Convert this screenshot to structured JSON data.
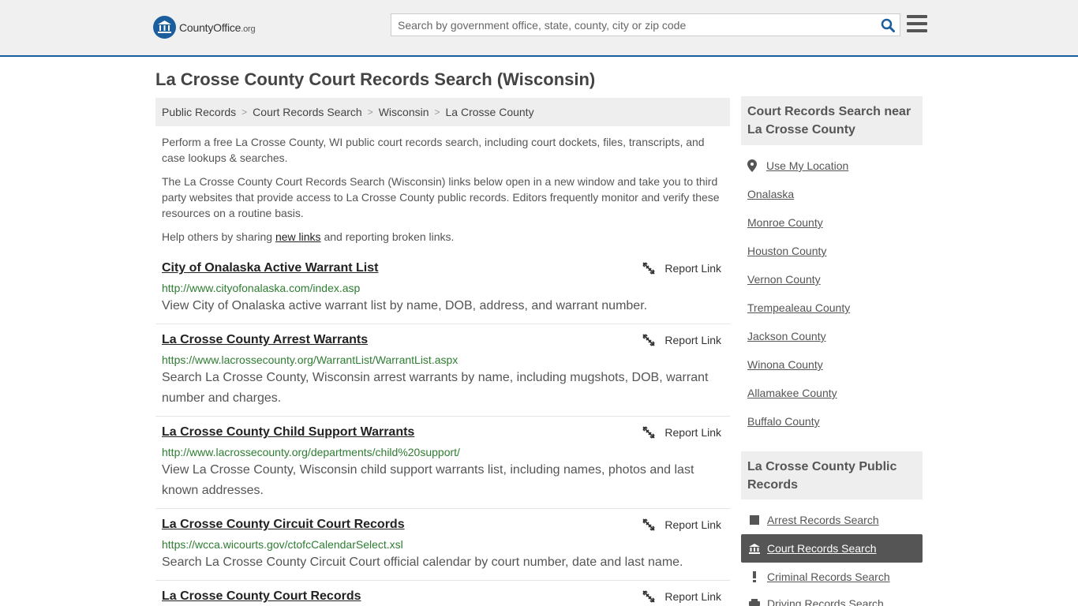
{
  "header": {
    "logo_main": "CountyOffice",
    "logo_suffix": ".org",
    "search_placeholder": "Search by government office, state, county, city or zip code"
  },
  "page_title": "La Crosse County Court Records Search (Wisconsin)",
  "breadcrumb": [
    "Public Records",
    "Court Records Search",
    "Wisconsin",
    "La Crosse County"
  ],
  "intro": {
    "p1": "Perform a free La Crosse County, WI public court records search, including court dockets, files, transcripts, and case lookups & searches.",
    "p2": "The La Crosse County Court Records Search (Wisconsin) links below open in a new window and take you to third party websites that provide access to La Crosse County public records. Editors frequently monitor and verify these resources on a routine basis.",
    "p3_before": "Help others by sharing ",
    "p3_link": "new links",
    "p3_after": " and reporting broken links."
  },
  "report_label": "Report Link",
  "results": [
    {
      "title": "City of Onalaska Active Warrant List",
      "url": "http://www.cityofonalaska.com/index.asp",
      "desc": "View City of Onalaska active warrant list by name, DOB, address, and warrant number."
    },
    {
      "title": "La Crosse County Arrest Warrants",
      "url": "https://www.lacrossecounty.org/WarrantList/WarrantList.aspx",
      "desc": "Search La Crosse County, Wisconsin arrest warrants by name, including mugshots, DOB, warrant number and charges."
    },
    {
      "title": "La Crosse County Child Support Warrants",
      "url": "http://www.lacrossecounty.org/departments/child%20support/",
      "desc": "View La Crosse County, Wisconsin child support warrants list, including names, photos and last known addresses."
    },
    {
      "title": "La Crosse County Circuit Court Records",
      "url": "https://wcca.wicourts.gov/ctofcCalendarSelect.xsl",
      "desc": "Search La Crosse County Circuit Court official calendar by court number, date and last name."
    },
    {
      "title": "La Crosse County Court Records",
      "url": "",
      "desc": ""
    }
  ],
  "sidebar": {
    "nearby_heading": "Court Records Search near La Crosse County",
    "use_location": "Use My Location",
    "nearby": [
      "Onalaska",
      "Monroe County",
      "Houston County",
      "Vernon County",
      "Trempealeau County",
      "Jackson County",
      "Winona County",
      "Allamakee County",
      "Buffalo County"
    ],
    "public_heading": "La Crosse County Public Records",
    "public_records": [
      {
        "label": "Arrest Records Search",
        "icon": "square-icon",
        "active": false
      },
      {
        "label": "Court Records Search",
        "icon": "courthouse-icon",
        "active": true
      },
      {
        "label": "Criminal Records Search",
        "icon": "exclamation-icon",
        "active": false
      },
      {
        "label": "Driving Records Search",
        "icon": "car-icon",
        "active": false
      }
    ]
  },
  "colors": {
    "accent": "#1b5e9e",
    "url_green": "#2e7d32",
    "active_item": "#555555"
  }
}
